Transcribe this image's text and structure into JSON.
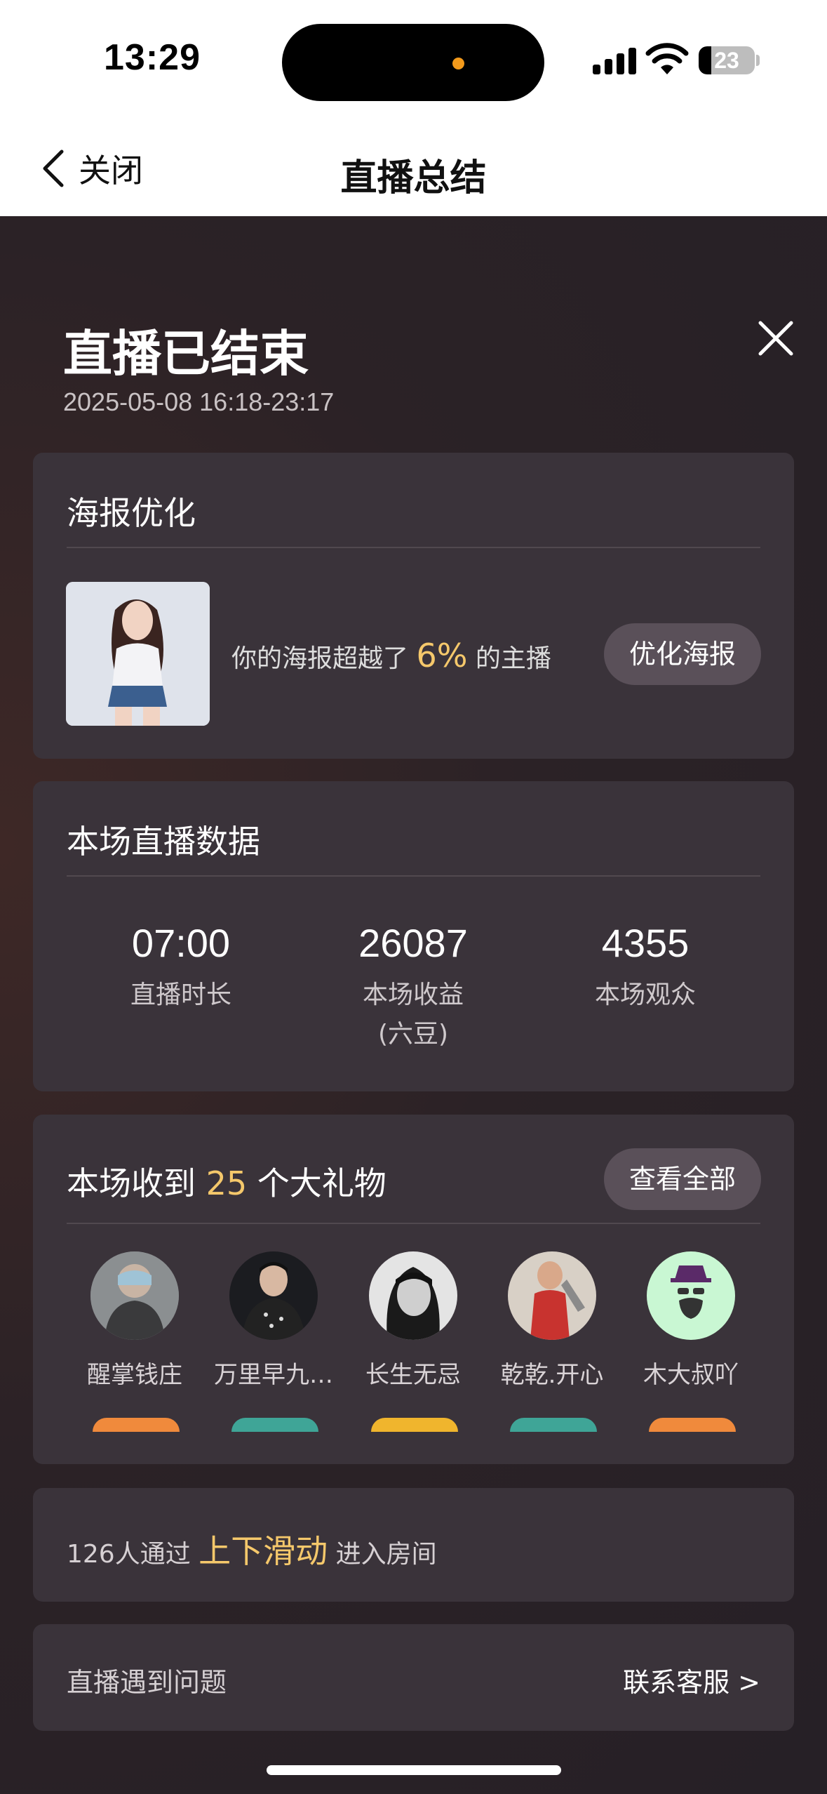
{
  "status_bar": {
    "time": "13:29",
    "battery": "23",
    "battery_level": 0.23
  },
  "nav": {
    "back_label": "关闭",
    "title": "直播总结"
  },
  "header": {
    "title": "直播已结束",
    "time_range": "2025-05-08 16:18-23:17"
  },
  "poster_card": {
    "title": "海报优化",
    "text_prefix": "你的海报超越了",
    "percent": "6%",
    "text_suffix": "的主播",
    "button": "优化海报"
  },
  "stats_card": {
    "title": "本场直播数据",
    "stats": [
      {
        "value": "07:00",
        "label": "直播时长"
      },
      {
        "value": "26087",
        "label": "本场收益",
        "sub": "(六豆)"
      },
      {
        "value": "4355",
        "label": "本场观众"
      }
    ]
  },
  "gifts_card": {
    "title_prefix": "本场收到",
    "count": "25",
    "title_suffix": "个大礼物",
    "button": "查看全部",
    "gifters": [
      {
        "name": "醒掌钱庄",
        "badge_color": "#f08a3c"
      },
      {
        "name": "万里早九…",
        "badge_color": "#3fa597"
      },
      {
        "name": "长生无忌",
        "badge_color": "#f0b52d"
      },
      {
        "name": "乾乾.开心",
        "badge_color": "#3fa597"
      },
      {
        "name": "木大叔吖",
        "badge_color": "#f08a3c"
      }
    ]
  },
  "slide_card": {
    "prefix": "126人通过",
    "highlight": "上下滑动",
    "suffix": "进入房间"
  },
  "help_card": {
    "label": "直播遇到问题",
    "link": "联系客服 >"
  },
  "colors": {
    "accent": "#f5c86b",
    "card": "#3a333a",
    "pill": "#5a5059"
  }
}
